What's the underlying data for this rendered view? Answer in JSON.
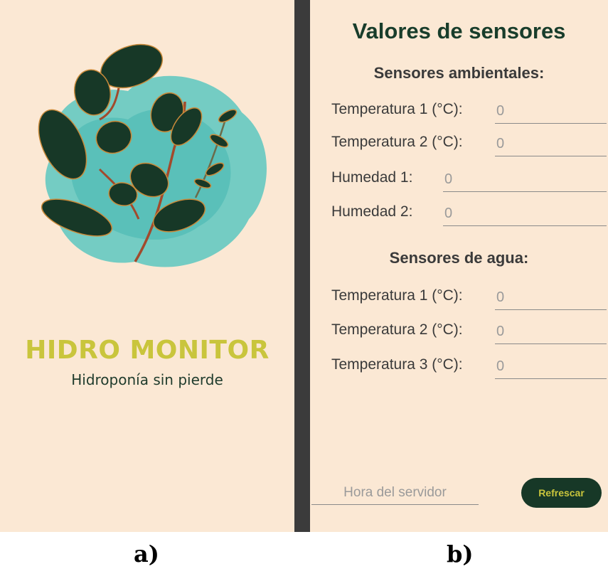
{
  "screen_a": {
    "app_title": "HIDRO MONITOR",
    "app_subtitle": "Hidroponía sin pierde",
    "caption": "a)"
  },
  "screen_b": {
    "title": "Valores de sensores",
    "ambient_section": {
      "heading": "Sensores ambientales:",
      "fields": [
        {
          "label": "Temperatura 1 (°C):",
          "value": "0"
        },
        {
          "label": "Temperatura 2 (°C):",
          "value": "0"
        },
        {
          "label": "Humedad 1:",
          "value": "0"
        },
        {
          "label": "Humedad 2:",
          "value": "0"
        }
      ]
    },
    "water_section": {
      "heading": "Sensores de agua:",
      "fields": [
        {
          "label": "Temperatura 1 (°C):",
          "value": "0"
        },
        {
          "label": "Temperatura 2 (°C):",
          "value": "0"
        },
        {
          "label": "Temperatura 3 (°C):",
          "value": "0"
        }
      ]
    },
    "server_time_placeholder": "Hora del servidor",
    "refresh_label": "Refrescar",
    "caption": "b)"
  },
  "colors": {
    "background": "#fbe8d4",
    "divider": "#3b3b3b",
    "brand_yellow": "#c9c53c",
    "dark_green": "#173827",
    "watercolor": "#5cc7bf"
  },
  "icons": {
    "logo": "leaves-logo-icon"
  }
}
